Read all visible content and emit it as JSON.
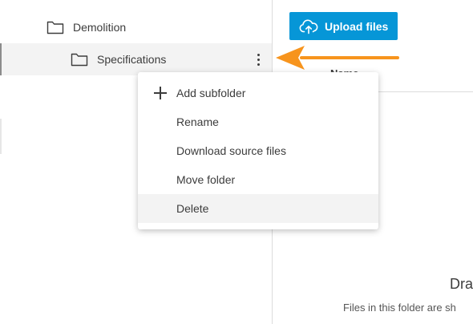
{
  "tree": {
    "items": [
      {
        "label": "Demolition",
        "icon": "folder-icon"
      },
      {
        "label": "Specifications",
        "icon": "folder-icon",
        "selected": true,
        "more_icon": "more-vertical-icon"
      }
    ]
  },
  "main": {
    "upload_label": "Upload files",
    "upload_icon": "cloud-upload-icon",
    "column_name": "Name",
    "dropzone_title": "Dra",
    "dropzone_text": "Files in this folder are sh"
  },
  "context_menu": {
    "items": [
      {
        "label": "Add subfolder",
        "icon": "plus-icon"
      },
      {
        "label": "Rename"
      },
      {
        "label": "Download source files"
      },
      {
        "label": "Move folder"
      },
      {
        "label": "Delete",
        "highlighted": true
      }
    ]
  },
  "colors": {
    "accent": "#0696d7",
    "annotation_arrow": "#f7941d",
    "selected_row": "#f3f3f3"
  }
}
